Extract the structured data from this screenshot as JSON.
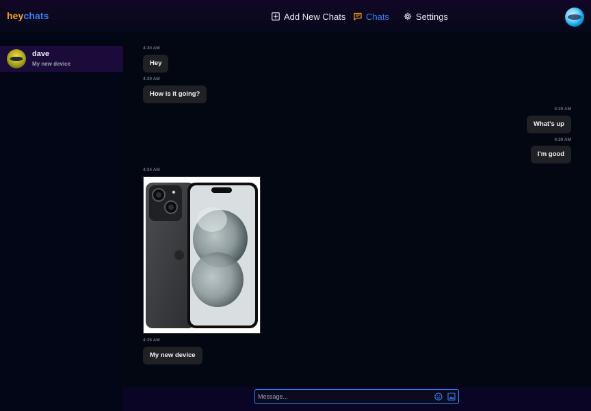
{
  "app": {
    "logo_part1": "hey",
    "logo_part2": "chats",
    "accent_color": "#3b82f6",
    "logo_color": "#f5a524"
  },
  "nav": {
    "add_new_chats": "Add New Chats",
    "add_icon": "plus-square-icon",
    "chats": "Chats",
    "chats_icon": "chat-bubble-icon",
    "settings": "Settings",
    "settings_icon": "gear-icon",
    "active": "chats"
  },
  "sidebar": {
    "contacts": [
      {
        "name": "dave",
        "preview": "My new device",
        "selected": true
      }
    ]
  },
  "messages": [
    {
      "time": "4:30 AM",
      "text": "Hey",
      "direction": "incoming"
    },
    {
      "time": "4:30 AM",
      "text": "How is it going?",
      "direction": "incoming"
    },
    {
      "time": "4:30 AM",
      "text": "What's up",
      "direction": "outgoing"
    },
    {
      "time": "4:30 AM",
      "text": "I'm good",
      "direction": "outgoing"
    },
    {
      "time": "4:34 AM",
      "image": "phone-photo",
      "direction": "incoming"
    },
    {
      "time": "4:35 AM",
      "text": "My new device",
      "direction": "incoming"
    }
  ],
  "composer": {
    "placeholder": "Message...",
    "value": "",
    "emoji_icon": "smiley-icon",
    "image_icon": "image-icon"
  }
}
